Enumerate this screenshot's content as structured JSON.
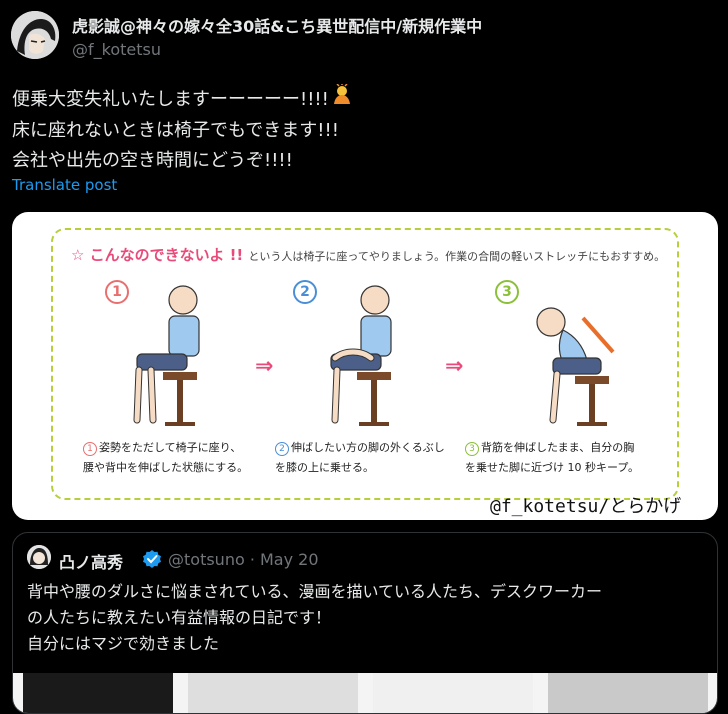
{
  "post": {
    "display_name": "虎影誠@神々の嫁々全30話&こち異世配信中/新規作業中",
    "handle": "@f_kotetsu",
    "lines": [
      "便乗大変失礼いたしますーーーーー!!!!",
      "床に座れないときは椅子でもできます!!!",
      "会社や出先の空き時間にどうぞ!!!!"
    ],
    "translate_label": "Translate post"
  },
  "image": {
    "headline": "☆ こんなのできないよ !!",
    "subline": "という人は椅子に座ってやりましょう。作業の合間の軽いストレッチにもおすすめ。",
    "steps": [
      {
        "num": "1",
        "caption_line1": "姿勢をただして椅子に座り、",
        "caption_line2": "腰や背中を伸ばした状態にする。"
      },
      {
        "num": "2",
        "caption_line1": "伸ばしたい方の脚の外くるぶし",
        "caption_line2": "を膝の上に乗せる。"
      },
      {
        "num": "3",
        "caption_line1": "背筋を伸ばしたまま、自分の胸",
        "caption_line2": "を乗せた脚に近づけ 10 秒キープ。"
      }
    ],
    "arrow": "⇒",
    "credit": "@f_kotetsu/とらかげ",
    "colors": {
      "pink": "#e84b7a",
      "step1": "#e86f6f",
      "step2": "#4a8fd6",
      "step3": "#8cbf3a",
      "frame": "#b6cf3a"
    }
  },
  "quote": {
    "display_name": "凸ノ高秀",
    "meta": "@totsuno · May 20",
    "lines": [
      "背中や腰のダルさに悩まされている、漫画を描いている人たち、デスクワーカー",
      "の人たちに教えたい有益情報の日記です！",
      "自分にはマジで効きました"
    ]
  },
  "theme": {
    "background": "#000000",
    "text": "#e7e9ea",
    "muted": "#71767b",
    "link": "#1d9bf0",
    "verified": "#1d9bf0"
  }
}
